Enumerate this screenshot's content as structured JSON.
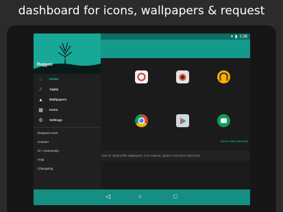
{
  "headline": "dashboard for icons, wallpapers & request",
  "status": {
    "time": "1:36"
  },
  "drawer": {
    "app_name": "Ruggon",
    "items": [
      {
        "label": "Home",
        "icon": "home-icon"
      },
      {
        "label": "Apply",
        "icon": "wand-icon"
      },
      {
        "label": "Wallpapers",
        "icon": "image-icon"
      },
      {
        "label": "Icons",
        "icon": "grid-icon"
      },
      {
        "label": "Settings",
        "icon": "gear-icon"
      }
    ],
    "secondary": [
      "Request Icons",
      "Contact",
      "G+ Community",
      "Help",
      "Changelog"
    ]
  },
  "content": {
    "apply_link": "RATE AND REVIEW",
    "info_text": "new for options like wallpapers, icon request, apply to launchers and more."
  },
  "colors": {
    "accent": "#149a8b",
    "active": "#19b8a8"
  }
}
